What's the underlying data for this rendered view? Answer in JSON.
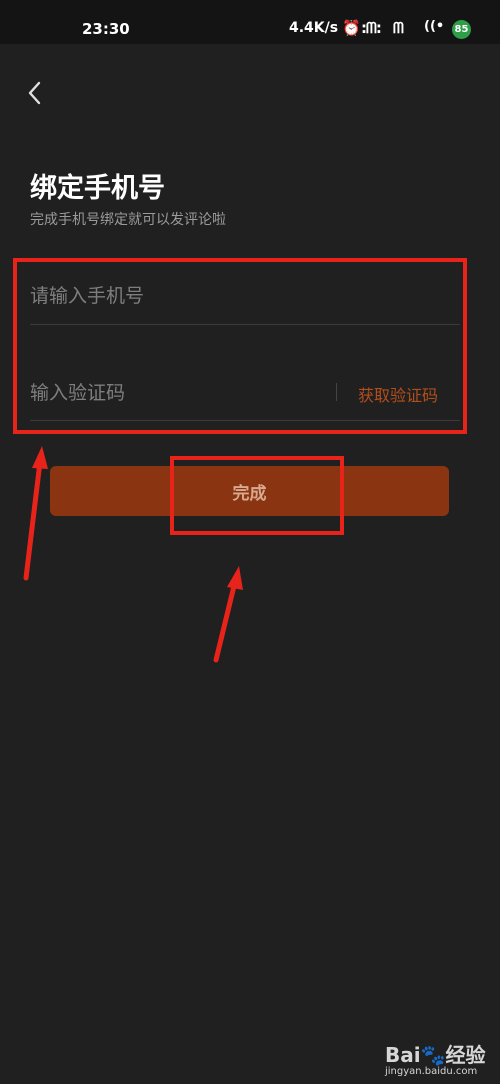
{
  "status_bar": {
    "time": "23:30",
    "network_speed": "4.4K/s",
    "battery": "85"
  },
  "header": {
    "title": "绑定手机号",
    "subtitle": "完成手机号绑定就可以发评论啦"
  },
  "form": {
    "phone_placeholder": "请输入手机号",
    "code_placeholder": "输入验证码",
    "get_code_label": "获取验证码",
    "submit_label": "完成"
  },
  "watermark": {
    "logo_text_1": "Bai",
    "logo_text_2": "du",
    "logo_text_3": "经验",
    "url": "jingyan.baidu.com"
  },
  "colors": {
    "background": "#202020",
    "accent": "#b34e1c",
    "button": "#8a3412",
    "annotation": "#e8241a"
  }
}
